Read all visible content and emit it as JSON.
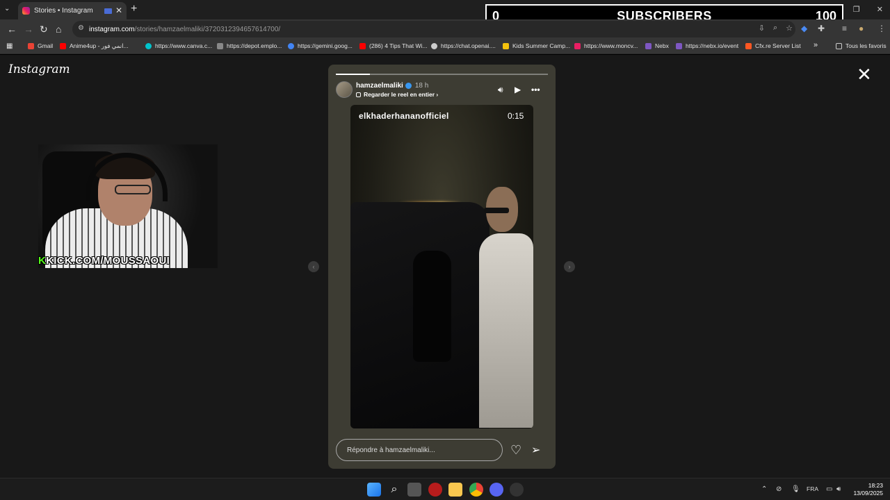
{
  "browser": {
    "tab_title": "Stories • Instagram",
    "url_host": "instagram.com",
    "url_path": "/stories/hamzaelmaliki/3720312394657614700/",
    "bookmarks": [
      {
        "label": "Gmail",
        "color": "#ea4335"
      },
      {
        "label": "Anime4up - انمي فور...",
        "color": "#ff0000"
      },
      {
        "label": "https://www.canva.c...",
        "color": "#00c4cc"
      },
      {
        "label": "https://depot.emplo...",
        "color": "#888888"
      },
      {
        "label": "https://gemini.goog...",
        "color": "#4285f4"
      },
      {
        "label": "(286) 4 Tips That Wi...",
        "color": "#ff0000"
      },
      {
        "label": "https://chat.openai....",
        "color": "#cccccc"
      },
      {
        "label": "Kids Summer Camp...",
        "color": "#f4c20d"
      },
      {
        "label": "https://www.moncv...",
        "color": "#e91e63"
      },
      {
        "label": "Nebx",
        "color": "#7e57c2"
      },
      {
        "label": "https://nebx.io/event",
        "color": "#7e57c2"
      },
      {
        "label": "Cfx.re Server List",
        "color": "#ff5722"
      }
    ],
    "all_bookmarks": "Tous les favoris"
  },
  "overlay": {
    "sub_current": "0",
    "sub_label": "SUBSCRIBERS",
    "sub_goal": "100",
    "kick_k": "K",
    "kick_text": "KICK.COM/MOUSSAOUI"
  },
  "instagram": {
    "logo": "Instagram",
    "story": {
      "progress": 0.16,
      "username": "hamzaelmaliki",
      "time": "18 h",
      "reel_link": "Regarder le reel en entier",
      "video_user": "elkhaderhananofficiel",
      "video_time": "0:15",
      "reply_placeholder": "Répondre à hamzaelmaliki..."
    }
  },
  "taskbar": {
    "lang": "FRA",
    "time": "18:23",
    "date": "13/09/2025"
  }
}
